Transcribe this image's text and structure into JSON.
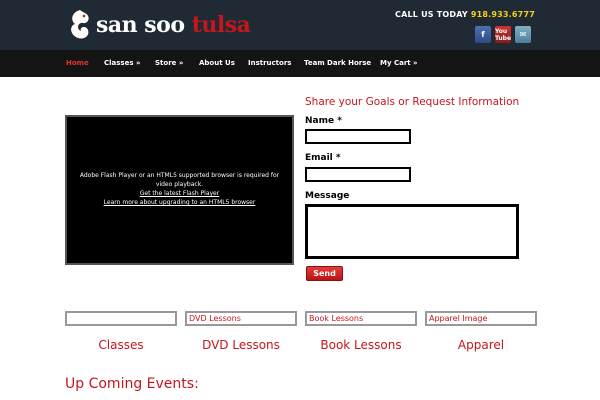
{
  "header": {
    "logo_text_1": "san soo",
    "logo_text_2": "tulsa",
    "call_label": "CALL US TODAY",
    "phone": "918.933.6777",
    "socials": [
      {
        "name": "facebook-icon",
        "glyph": "f"
      },
      {
        "name": "youtube-icon",
        "glyph": "You Tube"
      },
      {
        "name": "email-icon",
        "glyph": "✉"
      }
    ]
  },
  "nav": {
    "items": [
      {
        "label": "Home",
        "active": true
      },
      {
        "label": "Classes »"
      },
      {
        "label": "Store »"
      },
      {
        "label": "About Us"
      },
      {
        "label": "Instructors"
      },
      {
        "label": "Team Dark Horse"
      },
      {
        "label": "My Cart »"
      }
    ]
  },
  "video": {
    "message": "Adobe Flash Player or an HTML5 supported browser is required for video playback.",
    "link1": "Get the latest Flash Player",
    "link2": "Learn more about upgrading to an HTML5 browser"
  },
  "form": {
    "title": "Share your Goals or Request Information",
    "name_label": "Name *",
    "email_label": "Email *",
    "message_label": "Message",
    "send_label": "Send"
  },
  "products": [
    {
      "box_text": "",
      "label": "Classes"
    },
    {
      "box_text": "DVD Lessons",
      "label": "DVD Lessons"
    },
    {
      "box_text": "Book Lessons",
      "label": "Book Lessons"
    },
    {
      "box_text": "Apparel Image",
      "label": "Apparel"
    }
  ],
  "events_title": "Up Coming Events:",
  "colors": {
    "brand_red": "#c4161c",
    "header_bg": "#1f2a35",
    "nav_bg": "#141414",
    "phone_yellow": "#f2d21b"
  }
}
